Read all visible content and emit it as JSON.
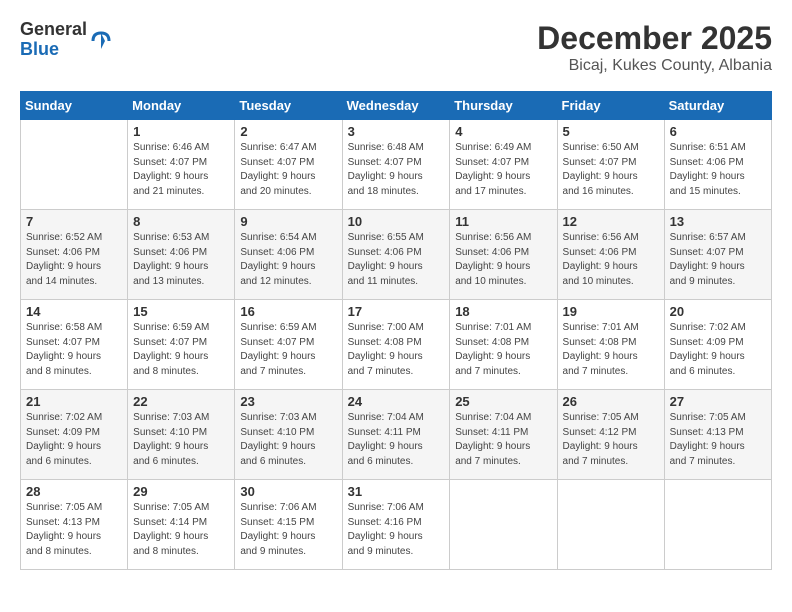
{
  "logo": {
    "general": "General",
    "blue": "Blue"
  },
  "title": "December 2025",
  "location": "Bicaj, Kukes County, Albania",
  "days_of_week": [
    "Sunday",
    "Monday",
    "Tuesday",
    "Wednesday",
    "Thursday",
    "Friday",
    "Saturday"
  ],
  "weeks": [
    [
      {
        "day": "",
        "info": ""
      },
      {
        "day": "1",
        "info": "Sunrise: 6:46 AM\nSunset: 4:07 PM\nDaylight: 9 hours\nand 21 minutes."
      },
      {
        "day": "2",
        "info": "Sunrise: 6:47 AM\nSunset: 4:07 PM\nDaylight: 9 hours\nand 20 minutes."
      },
      {
        "day": "3",
        "info": "Sunrise: 6:48 AM\nSunset: 4:07 PM\nDaylight: 9 hours\nand 18 minutes."
      },
      {
        "day": "4",
        "info": "Sunrise: 6:49 AM\nSunset: 4:07 PM\nDaylight: 9 hours\nand 17 minutes."
      },
      {
        "day": "5",
        "info": "Sunrise: 6:50 AM\nSunset: 4:07 PM\nDaylight: 9 hours\nand 16 minutes."
      },
      {
        "day": "6",
        "info": "Sunrise: 6:51 AM\nSunset: 4:06 PM\nDaylight: 9 hours\nand 15 minutes."
      }
    ],
    [
      {
        "day": "7",
        "info": "Sunrise: 6:52 AM\nSunset: 4:06 PM\nDaylight: 9 hours\nand 14 minutes."
      },
      {
        "day": "8",
        "info": "Sunrise: 6:53 AM\nSunset: 4:06 PM\nDaylight: 9 hours\nand 13 minutes."
      },
      {
        "day": "9",
        "info": "Sunrise: 6:54 AM\nSunset: 4:06 PM\nDaylight: 9 hours\nand 12 minutes."
      },
      {
        "day": "10",
        "info": "Sunrise: 6:55 AM\nSunset: 4:06 PM\nDaylight: 9 hours\nand 11 minutes."
      },
      {
        "day": "11",
        "info": "Sunrise: 6:56 AM\nSunset: 4:06 PM\nDaylight: 9 hours\nand 10 minutes."
      },
      {
        "day": "12",
        "info": "Sunrise: 6:56 AM\nSunset: 4:06 PM\nDaylight: 9 hours\nand 10 minutes."
      },
      {
        "day": "13",
        "info": "Sunrise: 6:57 AM\nSunset: 4:07 PM\nDaylight: 9 hours\nand 9 minutes."
      }
    ],
    [
      {
        "day": "14",
        "info": "Sunrise: 6:58 AM\nSunset: 4:07 PM\nDaylight: 9 hours\nand 8 minutes."
      },
      {
        "day": "15",
        "info": "Sunrise: 6:59 AM\nSunset: 4:07 PM\nDaylight: 9 hours\nand 8 minutes."
      },
      {
        "day": "16",
        "info": "Sunrise: 6:59 AM\nSunset: 4:07 PM\nDaylight: 9 hours\nand 7 minutes."
      },
      {
        "day": "17",
        "info": "Sunrise: 7:00 AM\nSunset: 4:08 PM\nDaylight: 9 hours\nand 7 minutes."
      },
      {
        "day": "18",
        "info": "Sunrise: 7:01 AM\nSunset: 4:08 PM\nDaylight: 9 hours\nand 7 minutes."
      },
      {
        "day": "19",
        "info": "Sunrise: 7:01 AM\nSunset: 4:08 PM\nDaylight: 9 hours\nand 7 minutes."
      },
      {
        "day": "20",
        "info": "Sunrise: 7:02 AM\nSunset: 4:09 PM\nDaylight: 9 hours\nand 6 minutes."
      }
    ],
    [
      {
        "day": "21",
        "info": "Sunrise: 7:02 AM\nSunset: 4:09 PM\nDaylight: 9 hours\nand 6 minutes."
      },
      {
        "day": "22",
        "info": "Sunrise: 7:03 AM\nSunset: 4:10 PM\nDaylight: 9 hours\nand 6 minutes."
      },
      {
        "day": "23",
        "info": "Sunrise: 7:03 AM\nSunset: 4:10 PM\nDaylight: 9 hours\nand 6 minutes."
      },
      {
        "day": "24",
        "info": "Sunrise: 7:04 AM\nSunset: 4:11 PM\nDaylight: 9 hours\nand 6 minutes."
      },
      {
        "day": "25",
        "info": "Sunrise: 7:04 AM\nSunset: 4:11 PM\nDaylight: 9 hours\nand 7 minutes."
      },
      {
        "day": "26",
        "info": "Sunrise: 7:05 AM\nSunset: 4:12 PM\nDaylight: 9 hours\nand 7 minutes."
      },
      {
        "day": "27",
        "info": "Sunrise: 7:05 AM\nSunset: 4:13 PM\nDaylight: 9 hours\nand 7 minutes."
      }
    ],
    [
      {
        "day": "28",
        "info": "Sunrise: 7:05 AM\nSunset: 4:13 PM\nDaylight: 9 hours\nand 8 minutes."
      },
      {
        "day": "29",
        "info": "Sunrise: 7:05 AM\nSunset: 4:14 PM\nDaylight: 9 hours\nand 8 minutes."
      },
      {
        "day": "30",
        "info": "Sunrise: 7:06 AM\nSunset: 4:15 PM\nDaylight: 9 hours\nand 9 minutes."
      },
      {
        "day": "31",
        "info": "Sunrise: 7:06 AM\nSunset: 4:16 PM\nDaylight: 9 hours\nand 9 minutes."
      },
      {
        "day": "",
        "info": ""
      },
      {
        "day": "",
        "info": ""
      },
      {
        "day": "",
        "info": ""
      }
    ]
  ]
}
